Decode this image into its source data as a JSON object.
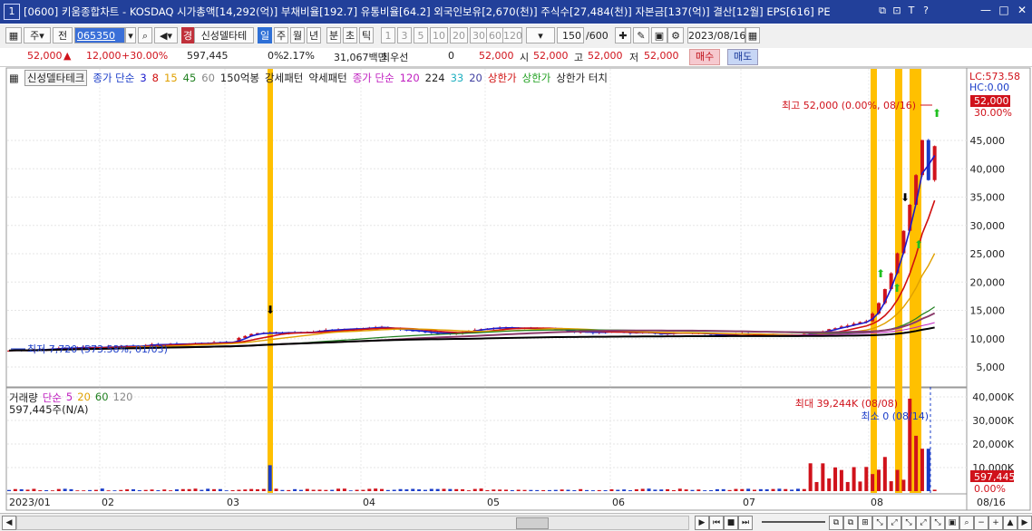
{
  "title": "[0600] 키움종합차트 - KOSDAQ 시가총액[14,292(억)] 부채비율[192.7] 유통비율[64.2] 외국인보유[2,670(천)] 주식수[27,484(천)] 자본금[137(억)] 결산[12월] EPS[616] PE",
  "window_number": "1",
  "toolbar": {
    "type_label": "주",
    "prev_label": "전",
    "code": "065350",
    "stock_name": "신성델타테",
    "badge": "경",
    "periods": [
      "일",
      "주",
      "월",
      "년",
      "분",
      "초",
      "틱"
    ],
    "intervals": [
      "1",
      "3",
      "5",
      "10",
      "20",
      "30",
      "60",
      "120"
    ],
    "count": "150",
    "count_max": "/600",
    "date": "2023/08/16"
  },
  "quote": {
    "price": "52,000",
    "change": "12,000",
    "change_pct": "+30.00%",
    "volume": "597,445",
    "vol_pct": "0%",
    "turnover_pct": "2.17%",
    "amount": "31,067백만",
    "best_label": "최우선",
    "best_qty": "0",
    "best_price": "52,000",
    "open_label": "시",
    "open": "52,000",
    "high_label": "고",
    "high": "52,000",
    "low_label": "저",
    "low": "52,000",
    "buy_label": "매수",
    "sell_label": "매도"
  },
  "legend": {
    "name": "신성델타테크",
    "ma_label": "종가 단순",
    "ma": [
      "3",
      "8",
      "15",
      "45",
      "60"
    ],
    "ma_colors": [
      "#1a1acc",
      "#d01010",
      "#e0a000",
      "#208020",
      "#888888"
    ],
    "envelope_label": "150억봉",
    "strong": "강세패턴",
    "weak": "약세패턴",
    "ma2_label": "종가 단순",
    "ma2": [
      "120",
      "224",
      "33",
      "20"
    ],
    "upper_limit": "상한가",
    "upper_limit2": "상한가",
    "upper_touch": "상한가 터치"
  },
  "volume_legend": {
    "label": "거래량",
    "ma_label": "단순",
    "ma": [
      "5",
      "20",
      "60",
      "120"
    ],
    "current": "597,445주(N/A)"
  },
  "annotations": {
    "high": "최고 52,000 (0.00%, 08/16)",
    "low": "최저 7,720 (573.58%, 01/03)",
    "vol_max": "최대 39,244K (08/08)",
    "vol_min": "최소 0 (08/14)",
    "lc": "LC:573.58",
    "hc": "HC:0.00",
    "price_tag": "52,000",
    "pct_tag": "30.00%",
    "vol_tag": "597,445",
    "vol_pct_tag": "0.00%"
  },
  "y_axis_price": [
    "45,000",
    "40,000",
    "35,000",
    "30,000",
    "25,000",
    "20,000",
    "15,000",
    "10,000",
    "5,000"
  ],
  "y_axis_volume": [
    "40,000K",
    "30,000K",
    "20,000K",
    "10,000K"
  ],
  "x_axis": [
    "2023/01",
    "02",
    "03",
    "04",
    "05",
    "06",
    "07",
    "08",
    "08/16"
  ],
  "colors": {
    "up": "#d0121b",
    "down": "#1a3cc8",
    "highlight": "#ffc000",
    "titlebar": "#22409a"
  },
  "chart_data": {
    "type": "candlestick",
    "x": [
      "01/03",
      "02",
      "03",
      "04",
      "05",
      "06",
      "07",
      "08/08",
      "08/16"
    ],
    "close": [
      7720,
      9500,
      11500,
      12500,
      11500,
      11500,
      11000,
      33000,
      52000
    ],
    "volume_max_k": 39244,
    "volume_min_k": 0,
    "price_high": 52000,
    "price_low": 7720
  }
}
